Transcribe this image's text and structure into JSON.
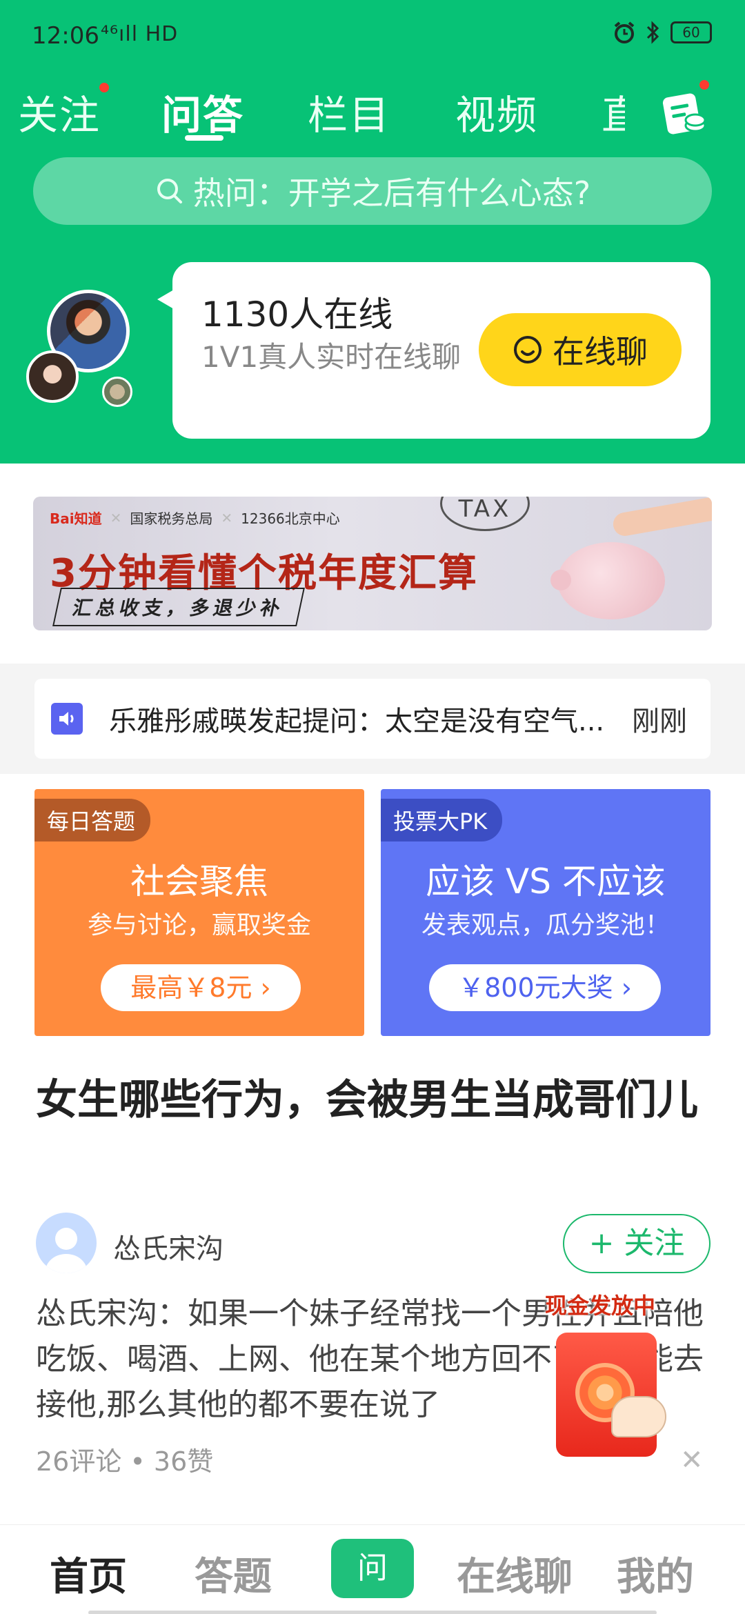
{
  "status_bar": {
    "time": "12:06",
    "network": "⁴⁶ıll HD",
    "battery": "60"
  },
  "tabs": [
    {
      "label": "关注"
    },
    {
      "label": "问答"
    },
    {
      "label": "栏目"
    },
    {
      "label": "视频"
    },
    {
      "label": "直"
    }
  ],
  "search": {
    "placeholder": "热问：开学之后有什么心态?"
  },
  "online": {
    "count": "1130人在线",
    "subtitle": "1V1真人实时在线聊",
    "chat_button": "在线聊"
  },
  "banner": {
    "brand_baidu": "Bai知道",
    "brand_tax": "国家税务总局",
    "brand_center": "12366北京中心",
    "title": "3分钟看懂个税年度汇算",
    "subtitle": "汇总收支，多退少补",
    "tax_word": "TAX"
  },
  "ticker": {
    "text": "乐雅彤戚暎发起提问：太空是没有空气...",
    "time": "刚刚"
  },
  "promos": [
    {
      "tag": "每日答题",
      "title": "社会聚焦",
      "subtitle": "参与讨论，赢取奖金",
      "button": "最高￥8元 ›"
    },
    {
      "tag": "投票大PK",
      "title": "应该 VS 不应该",
      "subtitle": "发表观点，瓜分奖池！",
      "button": "￥800元大奖 ›"
    }
  ],
  "feed": {
    "question": "女生哪些行为，会被男生当成哥们儿",
    "author": "怂氏宋沟",
    "follow_button": "+ 关注",
    "excerpt": "怂氏宋沟：如果一个妹子经常找一个男性并且陪他吃饭、喝酒、上网、他在某个地方回不了家你能去接他,那么其他的都不要在说了",
    "meta": "26评论 • 36赞",
    "dismiss": "✕"
  },
  "redpacket": {
    "label": "现金发放中"
  },
  "bottom_nav": {
    "home": "首页",
    "answer": "答题",
    "ask": "问",
    "chat": "在线聊",
    "mine": "我的"
  },
  "colors": {
    "brand_green": "#07c276",
    "chat_yellow": "#ffd51a",
    "promo_orange": "#ff8b3d",
    "promo_blue": "#5f75f5"
  }
}
